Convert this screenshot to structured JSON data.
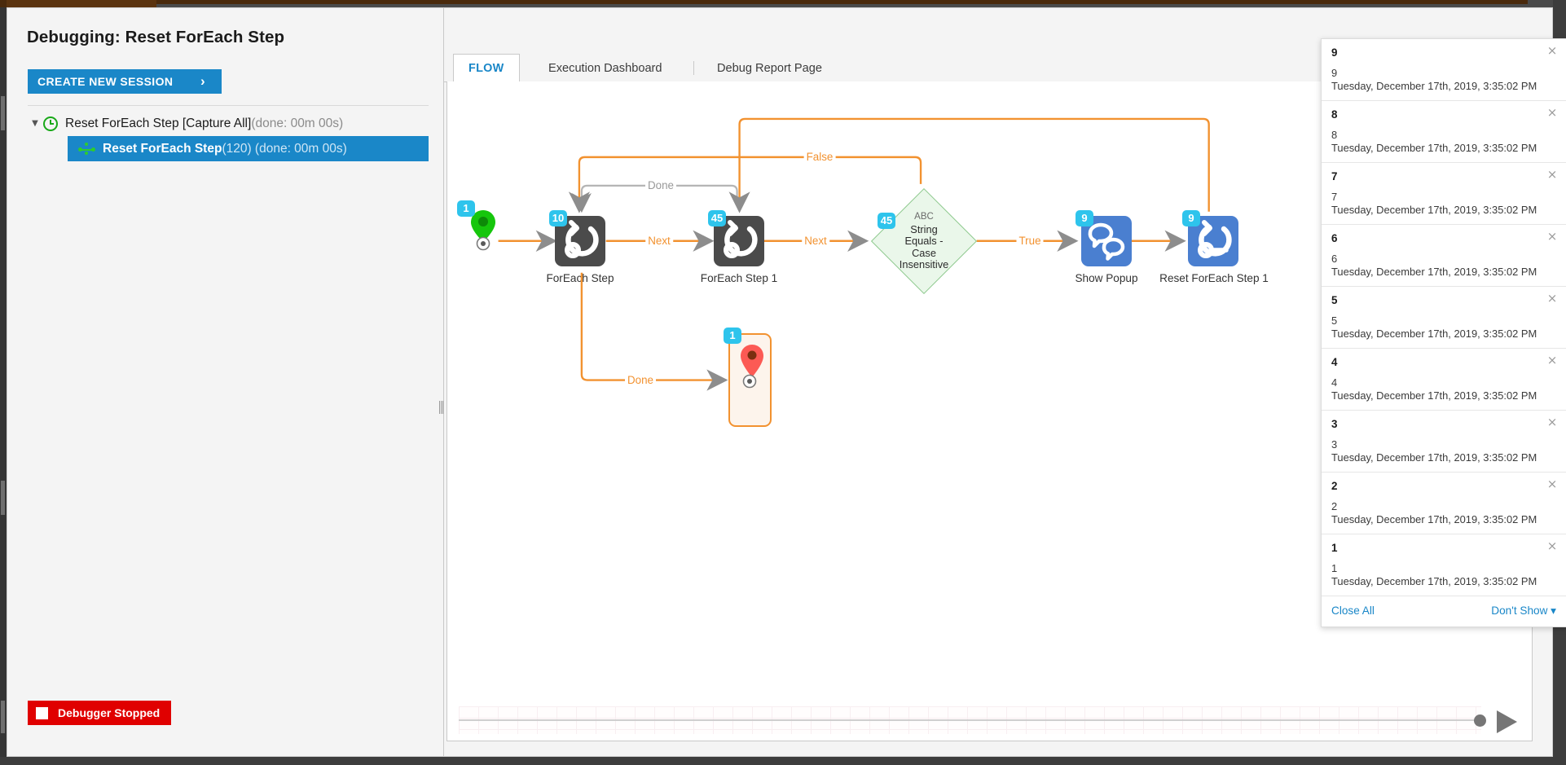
{
  "dialog": {
    "title": "Debugging: Reset ForEach Step",
    "close_icon": "close-icon"
  },
  "sidebar": {
    "create_session_label": "CREATE NEW SESSION",
    "create_session_chevron": "›",
    "tree": [
      {
        "icon": "clock-icon",
        "twisty": "▼",
        "label": "Reset ForEach Step [Capture All]",
        "meta": " (done: 00m 00s)",
        "selected": false
      },
      {
        "icon": "flow-graph-icon",
        "label": "Reset ForEach Step",
        "meta": " (120) (done: 00m 00s)",
        "selected": true
      }
    ],
    "status": {
      "label": "Debugger Stopped",
      "color": "#e00000"
    }
  },
  "tabs": [
    {
      "label": "FLOW",
      "active": true
    },
    {
      "label": "Execution Dashboard",
      "active": false
    },
    {
      "label": "Debug Report Page",
      "active": false
    }
  ],
  "flow": {
    "nodes": [
      {
        "id": "start",
        "label": "",
        "badge": "1",
        "kind": "start-pin"
      },
      {
        "id": "foreach",
        "label": "ForEach Step",
        "badge": "10",
        "kind": "foreach-dark"
      },
      {
        "id": "foreach1",
        "label": "ForEach Step 1",
        "badge": "45",
        "kind": "foreach-dark"
      },
      {
        "id": "decision",
        "label": "",
        "badge": "45",
        "kind": "decision",
        "text_top": "ABC",
        "text": "String Equals - Case Insensitive"
      },
      {
        "id": "showpopup",
        "label": "Show Popup",
        "badge": "9",
        "kind": "popup-blue"
      },
      {
        "id": "resetfe1",
        "label": "Reset ForEach Step 1",
        "badge": "9",
        "kind": "reset-blue"
      },
      {
        "id": "endpoint",
        "label": "",
        "badge": "1",
        "kind": "end-pin"
      }
    ],
    "edge_labels": [
      {
        "text": "Done",
        "style": "grey"
      },
      {
        "text": "Next",
        "style": "orange"
      },
      {
        "text": "Next",
        "style": "orange"
      },
      {
        "text": "False",
        "style": "orange"
      },
      {
        "text": "True",
        "style": "orange"
      },
      {
        "text": "Done",
        "style": "orange"
      }
    ],
    "colors": {
      "wire": "#f29230",
      "wire_grey": "#b5b5b5",
      "badge": "#2ec4ec",
      "node_dark": "#4b4b4b",
      "node_blue": "#4a7fd0",
      "decision_fill": "#eaf7ea",
      "decision_stroke": "#8ec98e"
    },
    "slider": {
      "play_icon": "play-icon",
      "value": 100
    }
  },
  "notifications": {
    "items": [
      {
        "title": "9",
        "line1": "9",
        "line2": "Tuesday, December 17th, 2019, 3:35:02 PM"
      },
      {
        "title": "8",
        "line1": "8",
        "line2": "Tuesday, December 17th, 2019, 3:35:02 PM"
      },
      {
        "title": "7",
        "line1": "7",
        "line2": "Tuesday, December 17th, 2019, 3:35:02 PM"
      },
      {
        "title": "6",
        "line1": "6",
        "line2": "Tuesday, December 17th, 2019, 3:35:02 PM"
      },
      {
        "title": "5",
        "line1": "5",
        "line2": "Tuesday, December 17th, 2019, 3:35:02 PM"
      },
      {
        "title": "4",
        "line1": "4",
        "line2": "Tuesday, December 17th, 2019, 3:35:02 PM"
      },
      {
        "title": "3",
        "line1": "3",
        "line2": "Tuesday, December 17th, 2019, 3:35:02 PM"
      },
      {
        "title": "2",
        "line1": "2",
        "line2": "Tuesday, December 17th, 2019, 3:35:02 PM"
      },
      {
        "title": "1",
        "line1": "1",
        "line2": "Tuesday, December 17th, 2019, 3:35:02 PM"
      }
    ],
    "close_all_label": "Close All",
    "dont_show_label": "Don't Show ▾",
    "item_close_icon": "×"
  }
}
